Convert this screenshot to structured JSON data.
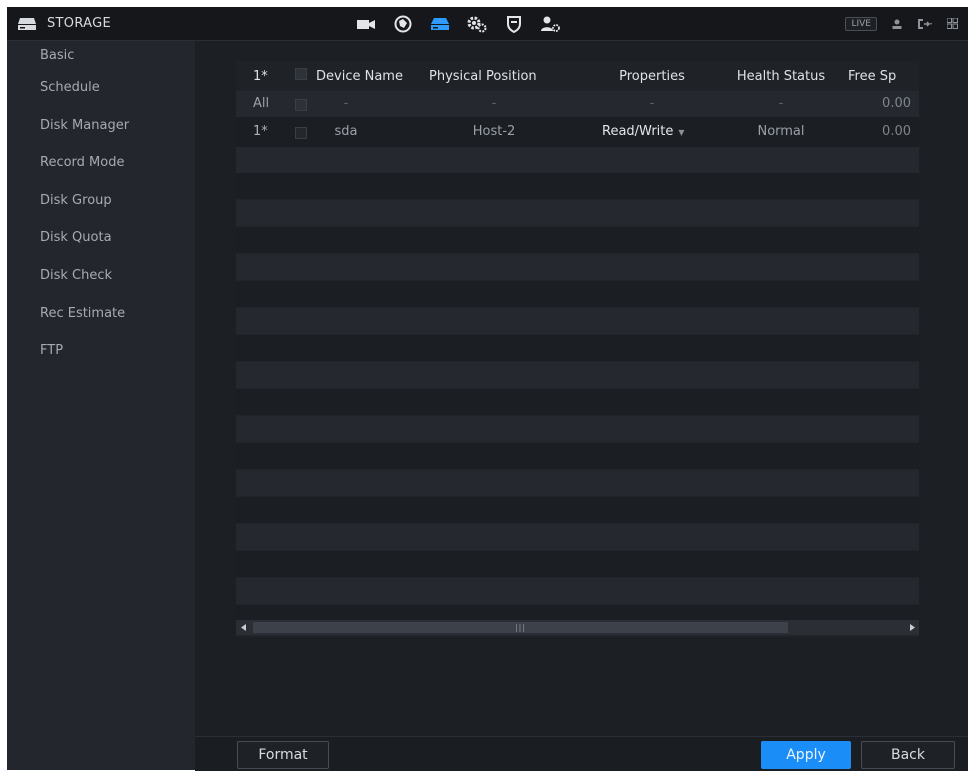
{
  "window": {
    "title": "STORAGE"
  },
  "topbar": {
    "modules": [
      {
        "icon": "camera-icon"
      },
      {
        "icon": "network-icon"
      },
      {
        "icon": "storage-icon",
        "active": true
      },
      {
        "icon": "system-gear-icon"
      },
      {
        "icon": "security-shield-icon"
      },
      {
        "icon": "account-icon"
      }
    ],
    "live_label": "LIVE",
    "tools": [
      "user-icon",
      "logout-icon",
      "grid-menu-icon"
    ]
  },
  "sidebar": {
    "items": [
      {
        "label": "Basic"
      },
      {
        "label": "Schedule"
      },
      {
        "label": "Disk Manager"
      },
      {
        "label": "Record Mode"
      },
      {
        "label": "Disk Group"
      },
      {
        "label": "Disk Quota"
      },
      {
        "label": "Disk Check"
      },
      {
        "label": "Rec Estimate"
      },
      {
        "label": "FTP"
      }
    ]
  },
  "table": {
    "headers": {
      "index": "1*",
      "device_name": "Device Name",
      "physical_position": "Physical Position",
      "properties": "Properties",
      "health_status": "Health Status",
      "free_space": "Free Sp"
    },
    "all_row": {
      "index": "All",
      "device_name": "-",
      "physical_position": "-",
      "properties": "-",
      "health_status": "-",
      "free_space": "0.00"
    },
    "rows": [
      {
        "index": "1*",
        "device_name": "sda",
        "physical_position": "Host-2",
        "properties": "Read/Write",
        "health_status": "Normal",
        "free_space": "0.00"
      }
    ]
  },
  "buttons": {
    "format": "Format",
    "apply": "Apply",
    "back": "Back"
  },
  "colors": {
    "accent": "#1a8ef6",
    "active_module": "#2f9bff"
  }
}
